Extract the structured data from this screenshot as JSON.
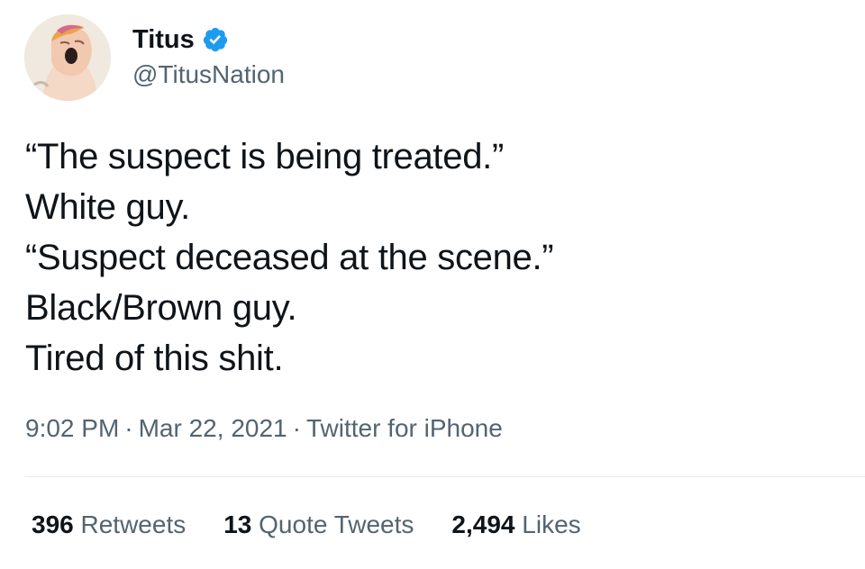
{
  "user": {
    "display_name": "Titus",
    "handle": "@TitusNation",
    "verified_icon": "verified-badge-icon",
    "verified_color": "#1d9bf0"
  },
  "tweet": {
    "lines": [
      "“The suspect is being treated.”",
      "White guy.",
      "“Suspect deceased at the scene.”",
      "Black/Brown guy.",
      "Tired of this shit."
    ]
  },
  "meta": {
    "time": "9:02 PM",
    "separator": "·",
    "date": "Mar 22, 2021",
    "source": "Twitter for iPhone"
  },
  "stats": {
    "retweets": {
      "count": "396",
      "label": "Retweets"
    },
    "quote_tweets": {
      "count": "13",
      "label": "Quote Tweets"
    },
    "likes": {
      "count": "2,494",
      "label": "Likes"
    }
  }
}
